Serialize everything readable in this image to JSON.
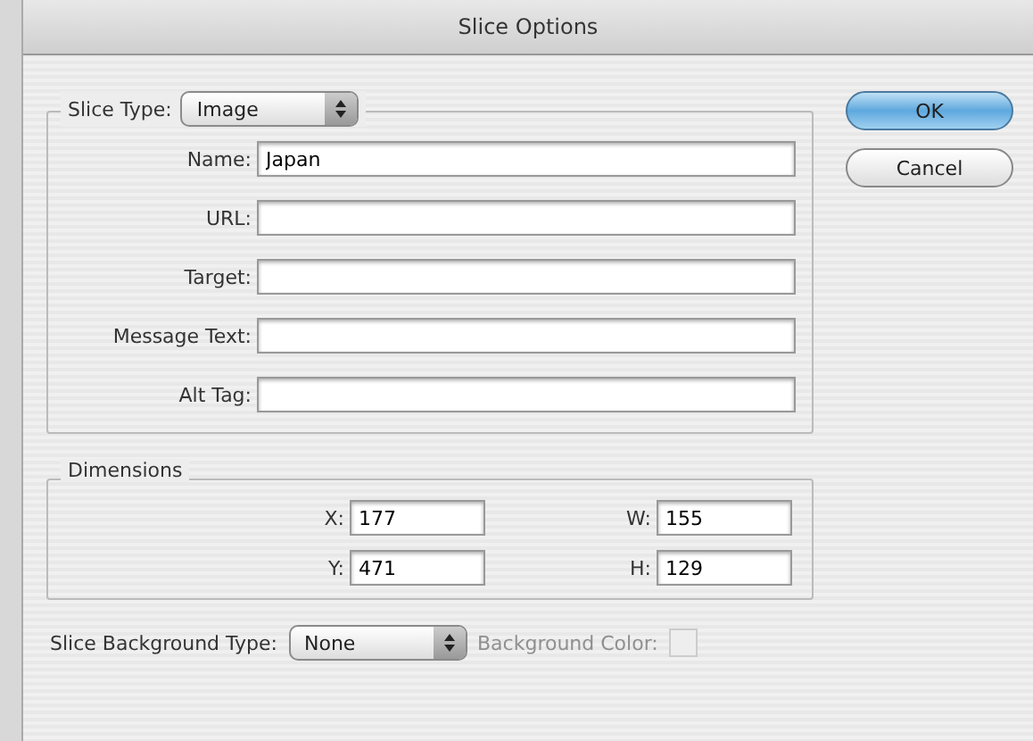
{
  "window": {
    "title": "Slice Options"
  },
  "slice_type": {
    "label": "Slice Type:",
    "value": "Image"
  },
  "fields": [
    {
      "label": "Name:",
      "value": "Japan"
    },
    {
      "label": "URL:"
    },
    {
      "label": "Target:"
    },
    {
      "label": "Message Text:"
    },
    {
      "label": "Alt Tag:"
    }
  ],
  "dimensions": {
    "title": "Dimensions",
    "fields": [
      {
        "label": "X:",
        "value": "177"
      },
      {
        "label": "W:",
        "value": "155"
      },
      {
        "label": "Y:",
        "value": "471"
      },
      {
        "label": "H:",
        "value": "129"
      }
    ]
  },
  "background_type": {
    "label": "Slice Background Type:",
    "value": "None"
  },
  "background_color": {
    "label": "Background Color:",
    "disabled": true
  },
  "buttons": [
    {
      "label": "OK",
      "kind": "default"
    },
    {
      "label": "Cancel",
      "kind": "normal"
    }
  ]
}
